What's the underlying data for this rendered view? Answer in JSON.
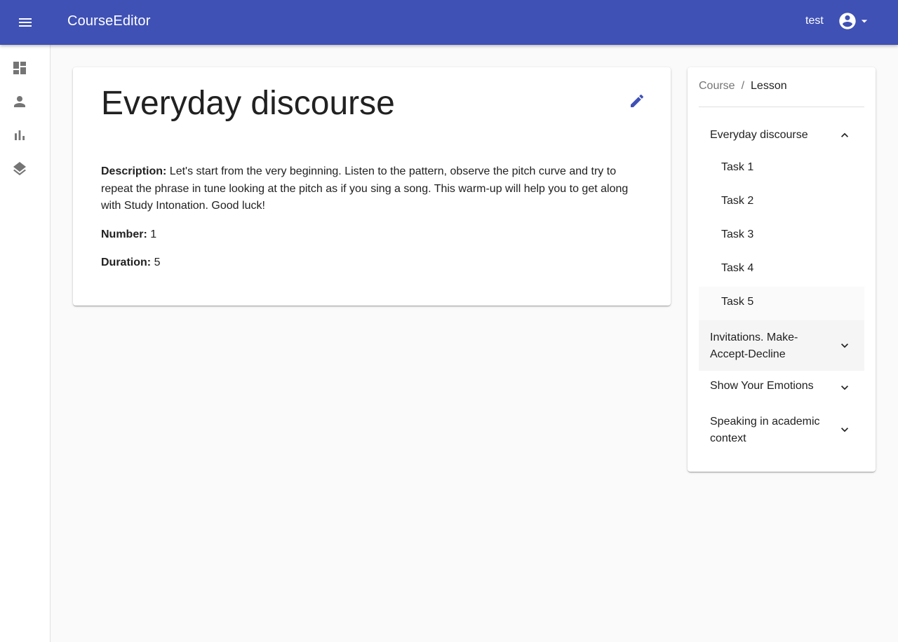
{
  "app": {
    "title": "CourseEditor",
    "user": "test"
  },
  "icons": {
    "menu": "menu-icon",
    "account": "account-circle-icon",
    "dropdown": "arrow-drop-down-icon",
    "dashboard": "dashboard-icon",
    "person": "person-icon",
    "chart": "bar-chart-icon",
    "layers": "layers-icon",
    "edit": "edit-pencil-icon",
    "expand_less": "chevron-up-icon",
    "expand_more": "chevron-down-icon"
  },
  "colors": {
    "primary": "#3f51b5",
    "background": "#fafafa",
    "text": "#212121",
    "muted": "#757575"
  },
  "lesson": {
    "title": "Everyday discourse",
    "description_label": "Description:",
    "description": "Let's start from the very beginning. Listen to the pattern, observe the pitch curve and try to repeat the phrase in tune looking at the pitch as if you sing a song. This warm-up will help you to get along with Study Intonation. Good luck!",
    "number_label": "Number:",
    "number": "1",
    "duration_label": "Duration:",
    "duration": "5"
  },
  "breadcrumb": {
    "course": "Course",
    "separator": "/",
    "lesson": "Lesson"
  },
  "sidebar": {
    "lessons": [
      {
        "label": "Everyday discourse",
        "expanded": true,
        "tasks": [
          "Task 1",
          "Task 2",
          "Task 3",
          "Task 4",
          "Task 5"
        ]
      },
      {
        "label": "Invitations. Make-Accept-Decline",
        "expanded": false
      },
      {
        "label": "Show Your Emotions",
        "expanded": false
      },
      {
        "label": "Speaking in academic context",
        "expanded": false
      }
    ]
  }
}
